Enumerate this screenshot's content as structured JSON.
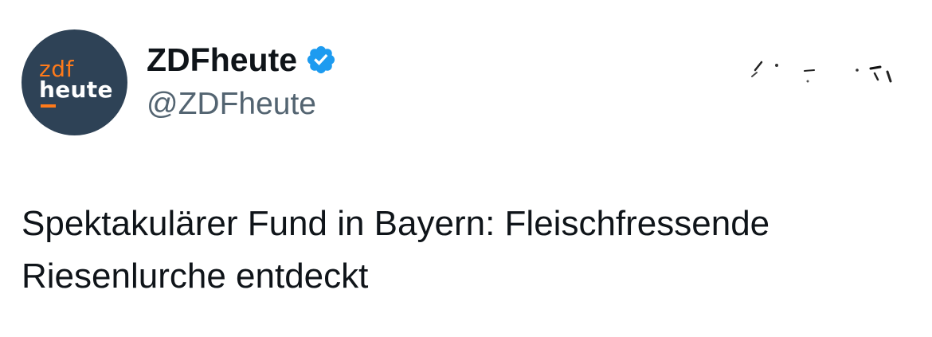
{
  "tweet": {
    "avatar": {
      "brand_top": "zdf",
      "brand_bottom": "heute",
      "background_color": "#2e4256",
      "accent_color": "#ff7a1a"
    },
    "author": {
      "display_name": "ZDFheute",
      "handle": "@ZDFheute",
      "verified": true,
      "verified_icon": "verified-badge-icon",
      "verified_color": "#1d9bf0"
    },
    "more_menu_icon": "more-options-icon",
    "text_line_1": "Spektakulärer Fund in Bayern: Fleischfressende",
    "text_line_2": "Riesenlurche entdeckt"
  }
}
